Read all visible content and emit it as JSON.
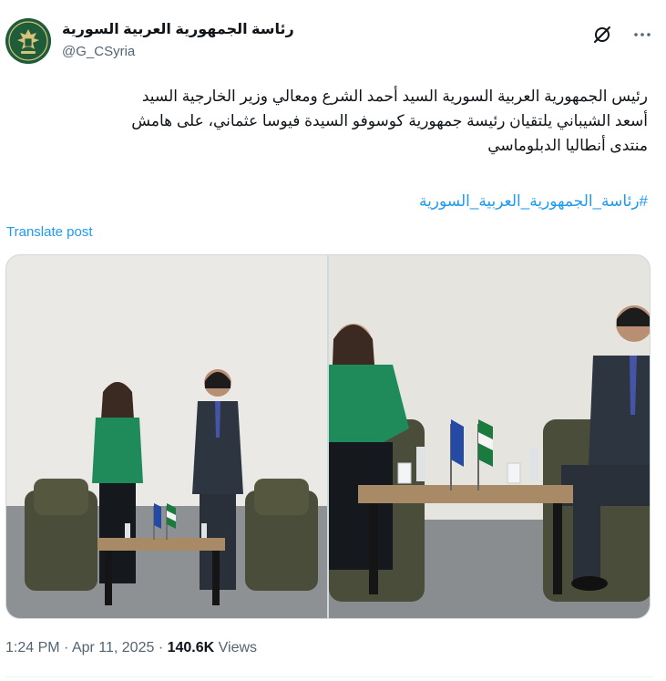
{
  "author": {
    "name": "رئاسة الجمهورية العربية السورية",
    "handle": "@G_CSyria",
    "avatar_icon": "syrian-eagle-emblem-icon"
  },
  "header_actions": {
    "grok_icon": "grok-icon",
    "more_icon": "more-dots-icon"
  },
  "post": {
    "text_lines": [
      "رئيس الجمهورية العربية السورية السيد أحمد الشرع ومعالي وزير الخارجية السيد",
      "أسعد الشيباني يلتقيان رئيسة جمهورية كوسوفو السيدة فيوسا عثماني، على هامش",
      "منتدى أنطاليا الدبلوماسي"
    ],
    "hashtag": "#رئاسة_الجمهورية_العربية_السورية",
    "translate_label": "Translate post"
  },
  "media": {
    "photo_count": 2
  },
  "meta": {
    "time": "1:24 PM",
    "sep1": "·",
    "date": "Apr 11, 2025",
    "sep2": "·",
    "views_count": "140.6K",
    "views_label": "Views"
  },
  "colors": {
    "link": "#1d9bf0",
    "text": "#0f1419",
    "secondary": "#536471",
    "avatar_bg": "#1f5c3a"
  }
}
